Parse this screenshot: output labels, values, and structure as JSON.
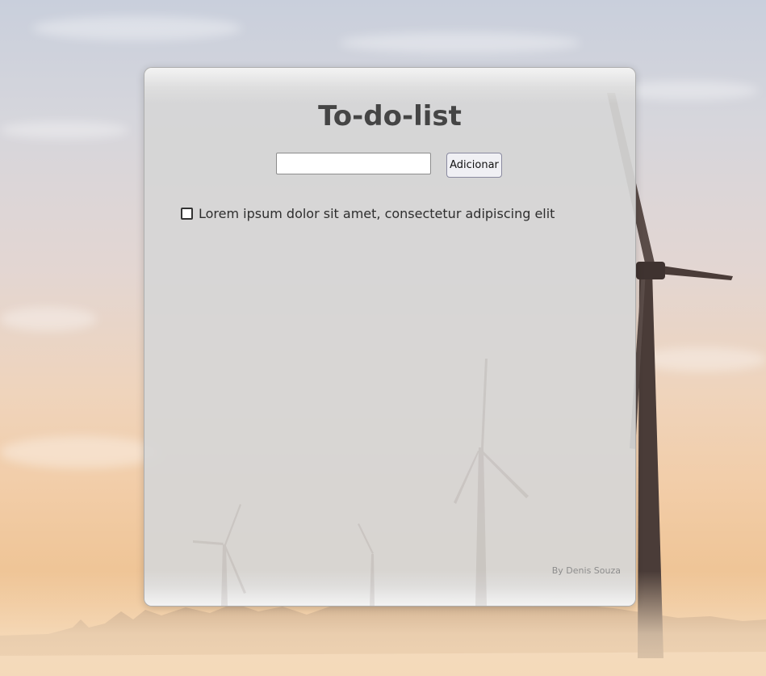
{
  "app": {
    "title": "To-do-list"
  },
  "form": {
    "input_value": "",
    "input_placeholder": "",
    "add_button_label": "Adicionar"
  },
  "tasks": [
    {
      "label": "Lorem ipsum dolor sit amet, consectetur adipiscing elit",
      "checked": false
    }
  ],
  "footer": {
    "credit": "By Denis Souza"
  },
  "background": {
    "scene": "wind turbines in misty sunrise field"
  },
  "colors": {
    "title": "#454545",
    "card": "#d6d6d6",
    "credit": "#8d8d8d"
  }
}
